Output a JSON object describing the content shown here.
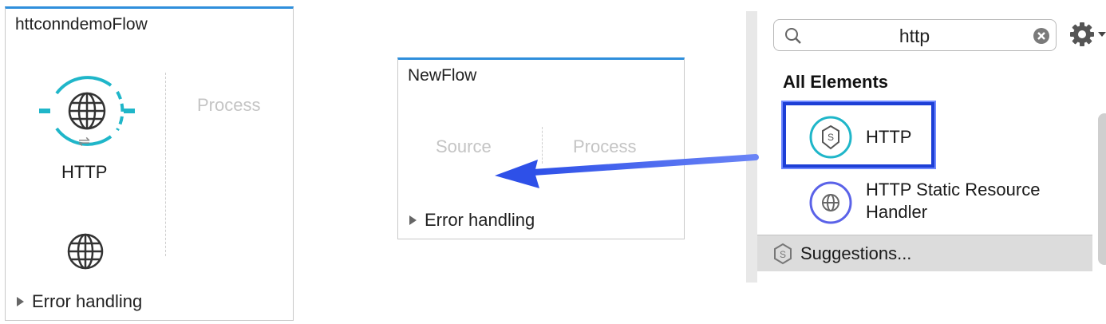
{
  "flow1": {
    "title": "httconndemoFlow",
    "process_label": "Process",
    "source_component_label": "HTTP",
    "swap_glyph": "⇌",
    "error_handling": "Error handling"
  },
  "flow2": {
    "title": "NewFlow",
    "source_label": "Source",
    "process_label": "Process",
    "error_handling": "Error handling"
  },
  "palette": {
    "search_value": "http",
    "section_title": "All Elements",
    "items": [
      {
        "label": "HTTP",
        "icon": "http-connector-icon"
      },
      {
        "label": "HTTP Static Resource\nHandler",
        "icon": "http-static-resource-icon"
      }
    ],
    "suggestions_label": "Suggestions..."
  },
  "colors": {
    "accent_blue": "#2f8fdc",
    "selection_blue": "#1d3fd6",
    "arrow_blue": "#3a5ef0",
    "http_teal": "#1fb6c9"
  }
}
